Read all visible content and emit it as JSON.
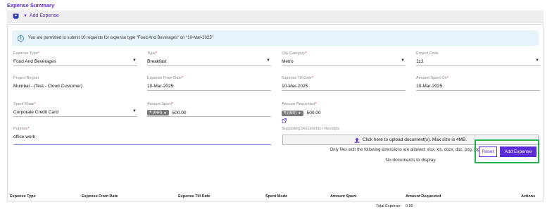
{
  "title": "Expense Summary",
  "toolbar": {
    "add_label": "Add Expense"
  },
  "info_text": "You are permitted to submit 10 requests for expense type \"Food And Beverages\" on \"10-Mar-2025\"",
  "fields": {
    "expense_type": {
      "label": "Expense Type",
      "value": "Food And Beverages"
    },
    "type": {
      "label": "Type",
      "value": "Breakfast"
    },
    "city_category": {
      "label": "City Category",
      "value": "Metro"
    },
    "project_code": {
      "label": "Project Code",
      "value": "113"
    },
    "project_region": {
      "label": "Project Region",
      "value": "Mumbai - (Test - Cloud Customer)"
    },
    "expense_from_date": {
      "label": "Expense From Date",
      "value": "10-Mar-2025"
    },
    "expense_till_date": {
      "label": "Expense Till Date",
      "value": "10-Mar-2025"
    },
    "amount_spent_on": {
      "label": "Amount Spent On",
      "value": "10-Mar-2025"
    },
    "spent_mode": {
      "label": "Spent Mode",
      "value": "Corporate Credit Card"
    },
    "amount_spent": {
      "label": "Amount Spent",
      "currency": "₹ (INR)",
      "value": "500.00"
    },
    "amount_requested": {
      "label": "Amount Requested",
      "currency": "₹ (INR)",
      "value": "500.00"
    },
    "purpose": {
      "label": "Purpose",
      "value": "office work"
    },
    "supporting_docs": {
      "label": "Supporting Documents / Receipts"
    }
  },
  "upload": {
    "button_label": "Click here to upload document(s). Max size is 4MB.",
    "note": "Only files with the following extensions are allowed: xlsx, xls, docx, doc, png, jpg, jpeg.",
    "no_docs": "No documents to display"
  },
  "buttons": {
    "reset": "Reset",
    "add": "Add Expense"
  },
  "table": {
    "headers": [
      "Expense Type",
      "Expense From Date",
      "Expense Till Date",
      "Spent Mode",
      "Amount Spent",
      "Amount Requested",
      "Actions"
    ],
    "total_label": "Total Expense:",
    "total_value": "0.00"
  },
  "colors": {
    "accent": "#5b2bd6",
    "highlight_box": "#24b04a",
    "info_bg": "#e6f3fb",
    "required": "#e53935"
  }
}
